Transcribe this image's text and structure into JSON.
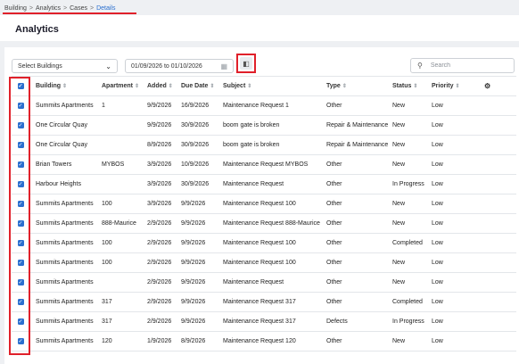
{
  "breadcrumb": {
    "items": [
      "Building",
      "Analytics",
      "Cases"
    ],
    "current": "Details",
    "separator": ">"
  },
  "page": {
    "title": "Analytics"
  },
  "filters": {
    "buildings_label": "Select Buildings",
    "date_range": "01/09/2026 to 01/10/2026",
    "search_placeholder": "Search"
  },
  "table": {
    "columns": [
      "Building",
      "Apartment",
      "Added",
      "Due Date",
      "Subject",
      "Type",
      "Status",
      "Priority"
    ],
    "rows": [
      [
        "Summits Apartments",
        "1",
        "9/9/2026",
        "16/9/2026",
        "Maintenance Request 1",
        "Other",
        "New",
        "Low"
      ],
      [
        "One Circular Quay",
        "",
        "9/9/2026",
        "30/9/2026",
        "boom gate is broken",
        "Repair & Maintenance",
        "New",
        "Low"
      ],
      [
        "One Circular Quay",
        "",
        "8/9/2026",
        "30/9/2026",
        "boom gate is broken",
        "Repair & Maintenance",
        "New",
        "Low"
      ],
      [
        "Brian Towers",
        "MYBOS",
        "3/9/2026",
        "10/9/2026",
        "Maintenance Request MYBOS",
        "Other",
        "New",
        "Low"
      ],
      [
        "Harbour Heights",
        "",
        "3/9/2026",
        "30/9/2026",
        "Maintenance Request",
        "Other",
        "In Progress",
        "Low"
      ],
      [
        "Summits Apartments",
        "100",
        "3/9/2026",
        "9/9/2026",
        "Maintenance Request 100",
        "Other",
        "New",
        "Low"
      ],
      [
        "Summits Apartments",
        "888-Maurice",
        "2/9/2026",
        "9/9/2026",
        "Maintenance Request 888-Maurice",
        "Other",
        "New",
        "Low"
      ],
      [
        "Summits Apartments",
        "100",
        "2/9/2026",
        "9/9/2026",
        "Maintenance Request 100",
        "Other",
        "Completed",
        "Low"
      ],
      [
        "Summits Apartments",
        "100",
        "2/9/2026",
        "9/9/2026",
        "Maintenance Request 100",
        "Other",
        "New",
        "Low"
      ],
      [
        "Summits Apartments",
        "",
        "2/9/2026",
        "9/9/2026",
        "Maintenance Request",
        "Other",
        "New",
        "Low"
      ],
      [
        "Summits Apartments",
        "317",
        "2/9/2026",
        "9/9/2026",
        "Maintenance Request 317",
        "Other",
        "Completed",
        "Low"
      ],
      [
        "Summits Apartments",
        "317",
        "2/9/2026",
        "9/9/2026",
        "Maintenance Request 317",
        "Defects",
        "In Progress",
        "Low"
      ],
      [
        "Summits Apartments",
        "120",
        "1/9/2026",
        "8/9/2026",
        "Maintenance Request 120",
        "Other",
        "New",
        "Low"
      ]
    ]
  },
  "icons": {
    "checkbox_checked": "check-icon",
    "sort": "sort-icon",
    "chevron": "chevron-down-icon",
    "calendar": "calendar-icon",
    "search": "search-icon",
    "column_settings": "column-settings-icon"
  },
  "colors": {
    "accent": "#2a6fcf",
    "annotation": "#e0202a",
    "background": "#eef0f3"
  }
}
